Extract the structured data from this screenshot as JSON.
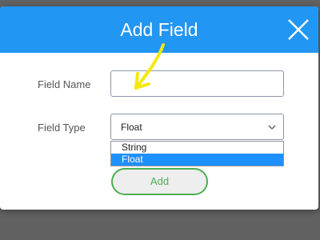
{
  "dialog": {
    "title": "Add Field",
    "close_icon": "close-icon"
  },
  "form": {
    "field_name": {
      "label": "Field Name",
      "value": "",
      "placeholder": ""
    },
    "field_type": {
      "label": "Field Type",
      "selected": "Float",
      "options": [
        {
          "label": "String",
          "highlighted": false
        },
        {
          "label": "Float",
          "highlighted": true
        }
      ]
    }
  },
  "actions": {
    "add_label": "Add"
  },
  "colors": {
    "header": "#2196f3",
    "add_button_border": "#4caf50",
    "highlight": "#1e90ff",
    "annotation_arrow": "#f5e90a"
  },
  "annotation": {
    "icon": "arrow-annotation-icon"
  }
}
